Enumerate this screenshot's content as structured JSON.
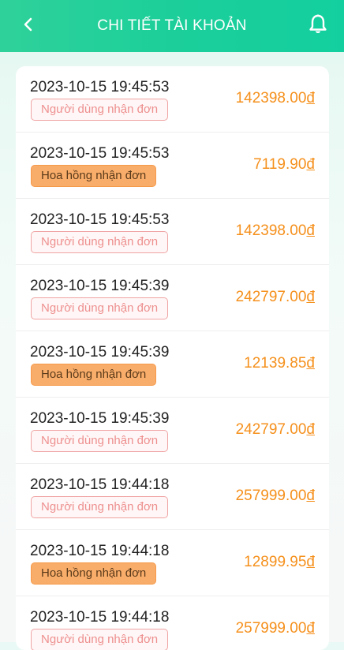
{
  "header": {
    "title": "CHI TIẾT TÀI KHOẢN",
    "back_icon": "chevron-left-icon",
    "bell_icon": "bell-icon"
  },
  "colors": {
    "header_start": "#2fd19a",
    "header_end": "#13cf9f",
    "amount": "#f5901c",
    "badge_user_border": "#f0a3a3",
    "badge_user_text": "#ee8f8f",
    "badge_comm_bg": "#f9ad6a"
  },
  "transactions": [
    {
      "time": "2023-10-15 19:45:53",
      "type": "user",
      "label": "Người dùng nhận đơn",
      "amount": "142398.00",
      "currency": "đ"
    },
    {
      "time": "2023-10-15 19:45:53",
      "type": "comm",
      "label": "Hoa hồng nhận đơn",
      "amount": "7119.90",
      "currency": "đ"
    },
    {
      "time": "2023-10-15 19:45:53",
      "type": "user",
      "label": "Người dùng nhận đơn",
      "amount": "142398.00",
      "currency": "đ"
    },
    {
      "time": "2023-10-15 19:45:39",
      "type": "user",
      "label": "Người dùng nhận đơn",
      "amount": "242797.00",
      "currency": "đ"
    },
    {
      "time": "2023-10-15 19:45:39",
      "type": "comm",
      "label": "Hoa hồng nhận đơn",
      "amount": "12139.85",
      "currency": "đ"
    },
    {
      "time": "2023-10-15 19:45:39",
      "type": "user",
      "label": "Người dùng nhận đơn",
      "amount": "242797.00",
      "currency": "đ"
    },
    {
      "time": "2023-10-15 19:44:18",
      "type": "user",
      "label": "Người dùng nhận đơn",
      "amount": "257999.00",
      "currency": "đ"
    },
    {
      "time": "2023-10-15 19:44:18",
      "type": "comm",
      "label": "Hoa hồng nhận đơn",
      "amount": "12899.95",
      "currency": "đ"
    },
    {
      "time": "2023-10-15 19:44:18",
      "type": "user",
      "label": "Người dùng nhận đơn",
      "amount": "257999.00",
      "currency": "đ"
    }
  ]
}
